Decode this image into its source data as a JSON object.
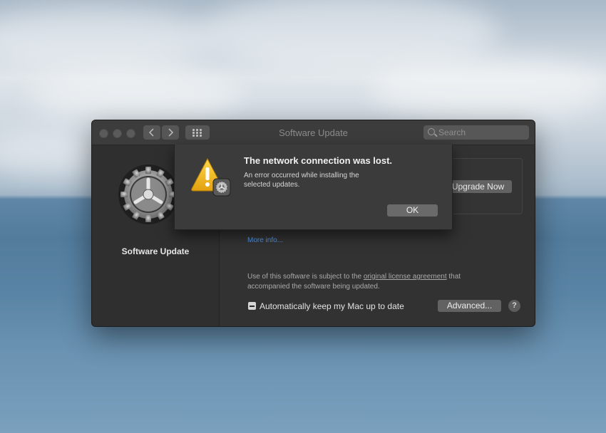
{
  "window": {
    "title": "Software Update",
    "search_placeholder": "Search",
    "back_icon": "chevron-left-icon",
    "forward_icon": "chevron-right-icon",
    "grid_icon": "grid-icon"
  },
  "sidebar": {
    "icon": "gear-icon",
    "label": "Software Update"
  },
  "main": {
    "upgrade_button": "Upgrade Now",
    "more_info": "More info...",
    "license_prefix": "Use of this software is subject to the ",
    "license_link": "original license agreement",
    "license_suffix": " that accompanied the software being updated.",
    "auto_update_label": "Automatically keep my Mac up to date",
    "auto_update_state": "mixed",
    "advanced_button": "Advanced...",
    "help_button": "?"
  },
  "alert": {
    "icon": "warning-icon",
    "title": "The network connection was lost.",
    "message": "An error occurred while installing the selected updates.",
    "ok_button": "OK"
  }
}
